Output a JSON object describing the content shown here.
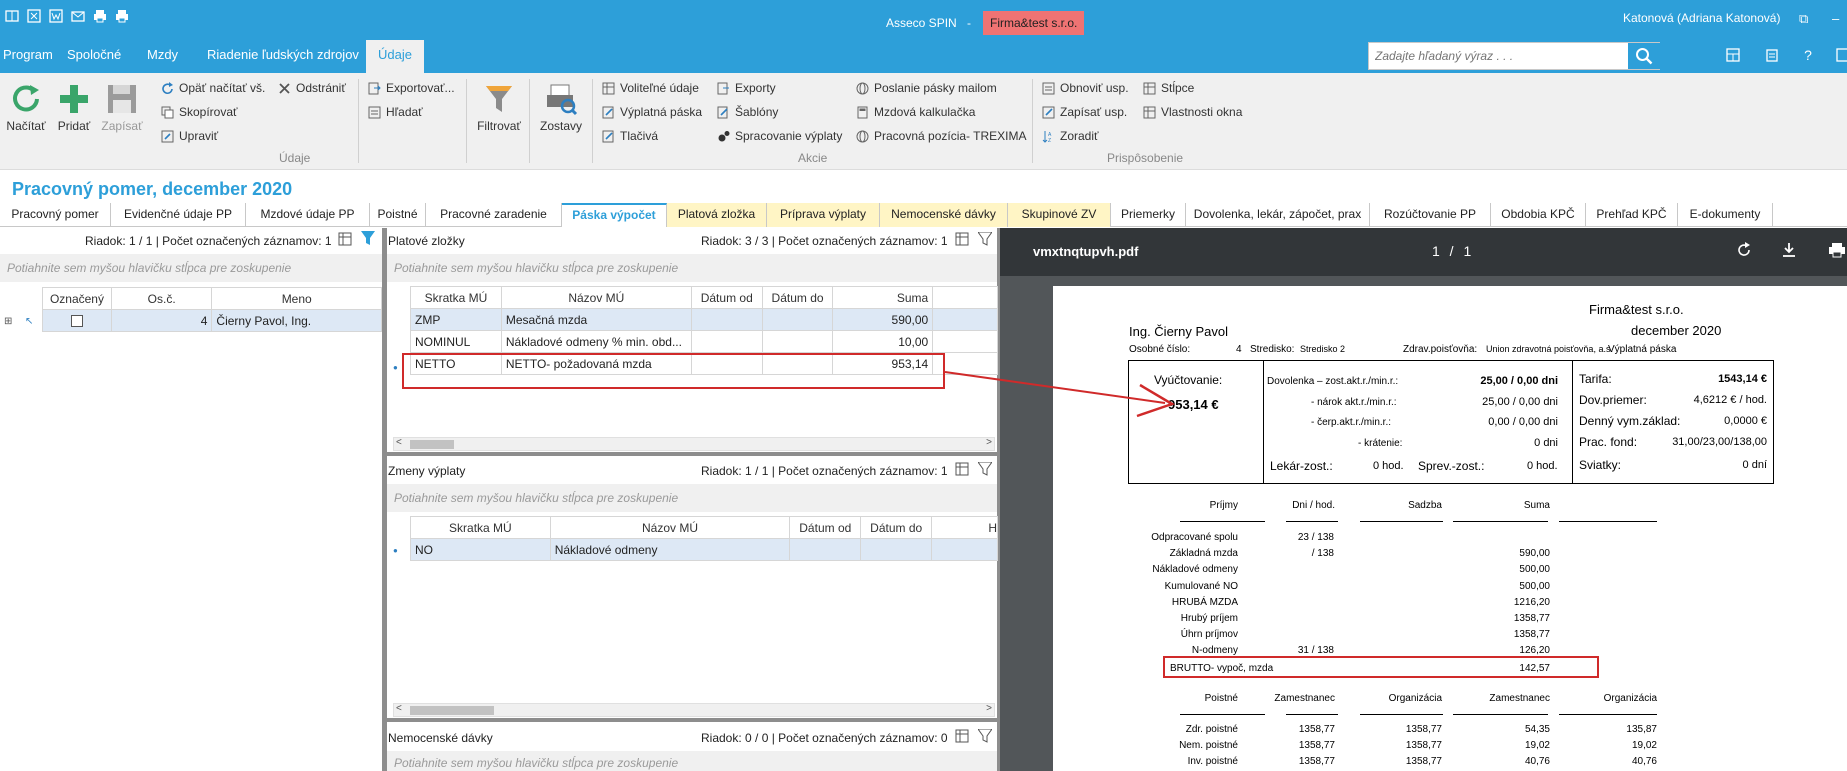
{
  "app": {
    "title": "Asseco SPIN",
    "dash": "-",
    "company": "Firma&test s.r.o.",
    "user": "Katonová (Adriana Katonová)"
  },
  "menu": [
    "Program",
    "Spoločné",
    "Mzdy",
    "Riadenie ľudských zdrojov",
    "Údaje"
  ],
  "search": {
    "placeholder": "Zadajte hľadaný výraz . . ."
  },
  "ribbon": {
    "big": [
      "Načítať",
      "Pridať",
      "Zapísať"
    ],
    "udaje_items": [
      "Opäť načítať vš.",
      "Odstrániť",
      "Skopírovať",
      "Upraviť",
      "Exportovať...",
      "Hľadať"
    ],
    "filter": "Filtrovať",
    "reports": "Zostavy",
    "akcie_items": [
      "Voliteľné údaje",
      "Výplatná páska",
      "Tlačivá",
      "Exporty",
      "Šablóny",
      "Spracovanie výplaty",
      "Poslanie pásky mailom",
      "Mzdová kalkulačka",
      "Pracovná pozícia- TREXIMA"
    ],
    "prisp_items": [
      "Obnoviť usp.",
      "Zapísať usp.",
      "Zoradiť",
      "Stĺpce",
      "Vlastnosti okna"
    ],
    "groups": [
      "Údaje",
      "Akcie",
      "Prispôsobenie"
    ]
  },
  "page": {
    "title": "Pracovný pomer, december 2020"
  },
  "tabs": [
    "Pracovný pomer",
    "Evidenčné údaje PP",
    "Mzdové údaje PP",
    "Poistné",
    "Pracovné zaradenie",
    "Páska výpočet",
    "Platová zložka",
    "Príprava výplaty",
    "Nemocenské dávky",
    "Skupinové ZV",
    "Priemerky",
    "Dovolenka, lekár, zápočet, prax",
    "Rozúčtovanie PP",
    "Obdobia KPČ",
    "Prehľad KPČ",
    "E-dokumenty"
  ],
  "left": {
    "status": "Riadok: 1 / 1 | Počet označených záznamov: 1",
    "hint": "Potiahnite sem myšou hlavičku stĺpca pre zoskupenie",
    "headers": [
      "Označený",
      "Os.č.",
      "Meno"
    ],
    "row": {
      "osc": "4",
      "meno": "Čierny Pavol, Ing."
    }
  },
  "platove": {
    "title": "Platové zložky",
    "status": "Riadok: 3 / 3 | Počet označených záznamov: 1",
    "hint": "Potiahnite sem myšou hlavičku stĺpca pre zoskupenie",
    "headers": [
      "Skratka MÚ",
      "Názov MÚ",
      "Dátum od",
      "Dátum do",
      "Suma"
    ],
    "rows": [
      {
        "skratka": "ZMP",
        "nazov": "Mesačná mzda",
        "suma": "590,00"
      },
      {
        "skratka": "NOMINUL",
        "nazov": "Nákladové odmeny % min. obd...",
        "suma": "10,00"
      },
      {
        "skratka": "NETTO",
        "nazov": "NETTO- požadovaná mzda",
        "suma": "953,14"
      }
    ]
  },
  "zmeny": {
    "title": "Zmeny výplaty",
    "status": "Riadok: 1 / 1 | Počet označených záznamov: 1",
    "hint": "Potiahnite sem myšou hlavičku stĺpca pre zoskupenie",
    "headers": [
      "Skratka MÚ",
      "Názov MÚ",
      "Dátum od",
      "Dátum do",
      "H"
    ],
    "row": {
      "skratka": "NO",
      "nazov": "Nákladové odmeny"
    }
  },
  "nemoc": {
    "title": "Nemocenské dávky",
    "status": "Riadok: 0 / 0 | Počet označených záznamov: 0",
    "hint": "Potiahnite sem myšou hlavičku stĺpca pre zoskupenie"
  },
  "pdf": {
    "file": "vmxtnqtupvh.pdf",
    "pages": "1 / 1",
    "company": "Firma&test s.r.o.",
    "period": "december 2020",
    "doctype": "Výplatná páska",
    "name": "Ing. Čierny Pavol",
    "meta": [
      "Osobné číslo:",
      "4",
      "Stredisko:",
      "Stredisko 2",
      "Zdrav.poisťovňa:",
      "Union zdravotná poisťovňa, a.s."
    ],
    "vyuct_label": "Vyúčtovanie:",
    "vyuct_value": "953,14 €",
    "dov": [
      [
        "Dovolenka – zost.akt.r./min.r.:",
        "25,00 / 0,00 dni"
      ],
      [
        "- nárok akt.r./min.r.:",
        "25,00 / 0,00 dni"
      ],
      [
        "- čerp.akt.r./min.r.:",
        "0,00 / 0,00 dni"
      ],
      [
        "- krátenie:",
        "0 dni"
      ]
    ],
    "lekar": [
      "Lekár-zost.:",
      "0 hod.",
      "Sprev.-zost.:",
      "0 hod."
    ],
    "tarif": [
      [
        "Tarifa:",
        "1543,14 €"
      ],
      [
        "Dov.priemer:",
        "4,6212 € / hod."
      ],
      [
        "Denný vym.základ:",
        "0,0000 €"
      ],
      [
        "Prac. fond:",
        "31,00/23,00/138,00"
      ],
      [
        "Sviatky:",
        "0 dní"
      ]
    ],
    "prijmy_headers": [
      "Príjmy",
      "Dni / hod.",
      "Sadzba",
      "Suma"
    ],
    "prijmy": [
      [
        "Odpracované spolu",
        "23 / 138",
        ""
      ],
      [
        "Základná mzda",
        "/ 138",
        "590,00"
      ],
      [
        "Nákladové odmeny",
        "",
        "500,00"
      ],
      [
        "Kumulované NO",
        "",
        "500,00"
      ],
      [
        "HRUBÁ MZDA",
        "",
        "1216,20"
      ],
      [
        "Hrubý príjem",
        "",
        "1358,77"
      ],
      [
        "Úhrn príjmov",
        "",
        "1358,77"
      ],
      [
        "N-odmeny",
        "31 / 138",
        "126,20"
      ],
      [
        "BRUTTO- vypoč, mzda",
        "",
        "142,57"
      ]
    ],
    "poistne_headers": [
      "Poistné",
      "Zamestnanec",
      "Organizácia",
      "Zamestnanec",
      "Organizácia"
    ],
    "poistne": [
      [
        "Zdr. poistné",
        "1358,77",
        "1358,77",
        "54,35",
        "135,87"
      ],
      [
        "Nem. poistné",
        "1358,77",
        "1358,77",
        "19,02",
        "19,02"
      ],
      [
        "Inv. poistné",
        "1358,77",
        "1358,77",
        "40,76",
        "40,76"
      ]
    ]
  }
}
